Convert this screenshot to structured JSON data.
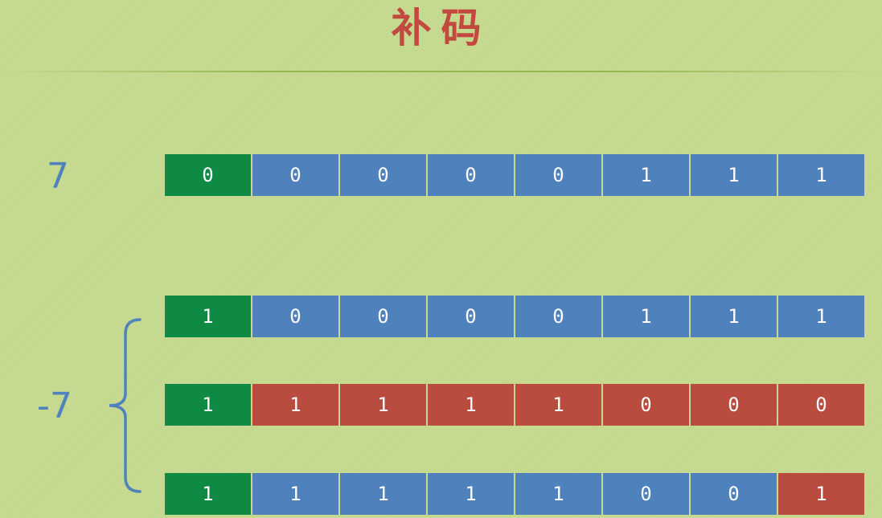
{
  "title": "补码",
  "labels": {
    "positive": "7",
    "negative": "-7"
  },
  "colors": {
    "sign_bit": "#0f8a45",
    "blue_bit": "#4f81bd",
    "red_bit": "#b94c3e",
    "title": "#c2493f",
    "label": "#4f81bd"
  },
  "rows": [
    {
      "bits": [
        "0",
        "0",
        "0",
        "0",
        "0",
        "1",
        "1",
        "1"
      ],
      "colors": [
        "sign",
        "blue",
        "blue",
        "blue",
        "blue",
        "blue",
        "blue",
        "blue"
      ]
    },
    {
      "bits": [
        "1",
        "0",
        "0",
        "0",
        "0",
        "1",
        "1",
        "1"
      ],
      "colors": [
        "sign",
        "blue",
        "blue",
        "blue",
        "blue",
        "blue",
        "blue",
        "blue"
      ]
    },
    {
      "bits": [
        "1",
        "1",
        "1",
        "1",
        "1",
        "0",
        "0",
        "0"
      ],
      "colors": [
        "sign",
        "red",
        "red",
        "red",
        "red",
        "red",
        "red",
        "red"
      ]
    },
    {
      "bits": [
        "1",
        "1",
        "1",
        "1",
        "1",
        "0",
        "0",
        "1"
      ],
      "colors": [
        "sign",
        "blue",
        "blue",
        "blue",
        "blue",
        "blue",
        "blue",
        "red"
      ]
    }
  ]
}
